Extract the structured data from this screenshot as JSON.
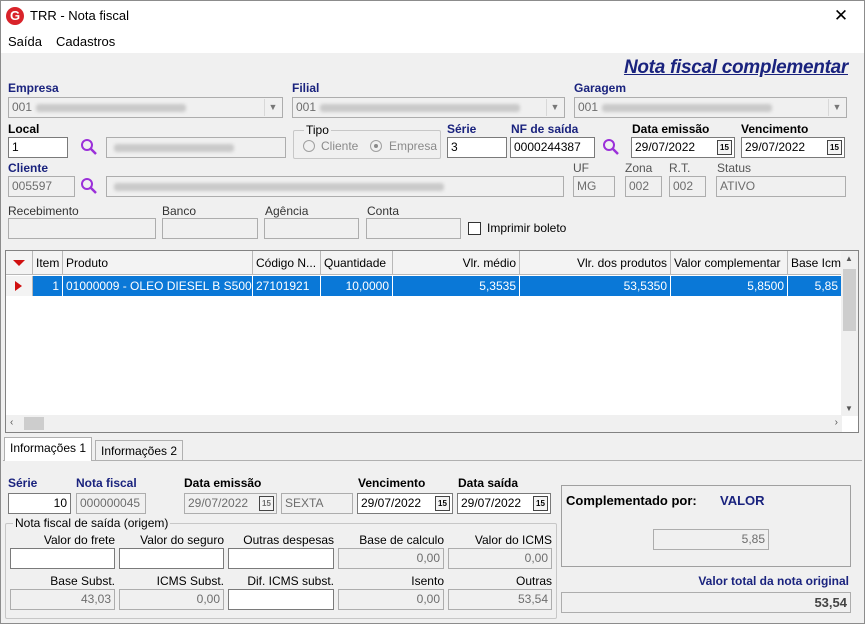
{
  "window": {
    "title": "TRR - Nota fiscal",
    "logo_letter": "G",
    "close": "✕"
  },
  "menu": [
    "Saída",
    "Cadastros"
  ],
  "page_title": "Nota fiscal complementar",
  "empresa": {
    "label": "Empresa",
    "code": "001"
  },
  "filial": {
    "label": "Filial",
    "code": "001"
  },
  "garagem": {
    "label": "Garagem",
    "code": "001"
  },
  "local": {
    "label": "Local",
    "value": "1"
  },
  "tipo": {
    "label": "Tipo",
    "opt1": "Cliente",
    "opt2": "Empresa",
    "selected": "Empresa"
  },
  "serie": {
    "label": "Série",
    "value": "3"
  },
  "nf_saida": {
    "label": "NF de saída",
    "value": "0000244387"
  },
  "data_emissao": {
    "label": "Data emissão",
    "value": "29/07/2022"
  },
  "vencimento": {
    "label": "Vencimento",
    "value": "29/07/2022"
  },
  "cliente": {
    "label": "Cliente",
    "value": "005597"
  },
  "uf": {
    "label": "UF",
    "value": "MG"
  },
  "zona": {
    "label": "Zona",
    "value": "002"
  },
  "rt": {
    "label": "R.T.",
    "value": "002"
  },
  "status": {
    "label": "Status",
    "value": "ATIVO"
  },
  "recebimento": {
    "label": "Recebimento",
    "value": ""
  },
  "banco": {
    "label": "Banco",
    "value": ""
  },
  "agencia": {
    "label": "Agência",
    "value": ""
  },
  "conta": {
    "label": "Conta",
    "value": ""
  },
  "imprimir_boleto": {
    "label": "Imprimir boleto",
    "checked": false
  },
  "grid": {
    "columns": [
      "Item",
      "Produto",
      "Código N...",
      "Quantidade",
      "Vlr. médio",
      "Vlr. dos produtos",
      "Valor complementar",
      "Base Icm"
    ],
    "rows": [
      {
        "item": "1",
        "produto": "01000009 - OLEO DIESEL B S500",
        "codigo": "27101921",
        "quantidade": "10,0000",
        "vlr_medio": "5,3535",
        "vlr_produtos": "53,5350",
        "valor_complementar": "5,8500",
        "base_icm": "5,85"
      }
    ]
  },
  "tabs": [
    "Informações 1",
    "Informações 2"
  ],
  "info": {
    "serie_label": "Série",
    "serie_value": "10",
    "nota_label": "Nota fiscal",
    "nota_value": "000000045",
    "data_emissao_label": "Data emissão",
    "data_emissao_value": "29/07/2022",
    "dia_semana": "SEXTA",
    "vencimento_label": "Vencimento",
    "vencimento_value": "29/07/2022",
    "data_saida_label": "Data saída",
    "data_saida_value": "29/07/2022",
    "group_label": "Nota fiscal de saída (origem)",
    "valor_frete_label": "Valor do frete",
    "valor_frete": "",
    "valor_seguro_label": "Valor do seguro",
    "valor_seguro": "",
    "outras_despesas_label": "Outras despesas",
    "outras_despesas": "",
    "base_calculo_label": "Base de calculo",
    "base_calculo": "0,00",
    "valor_icms_label": "Valor do ICMS",
    "valor_icms": "0,00",
    "base_subst_label": "Base Subst.",
    "base_subst": "43,03",
    "icms_subst_label": "ICMS Subst.",
    "icms_subst": "0,00",
    "dif_icms_label": "Dif. ICMS subst.",
    "dif_icms": "",
    "isento_label": "Isento",
    "isento": "0,00",
    "outras_label": "Outras",
    "outras": "53,54"
  },
  "complementado": {
    "label": "Complementado por:",
    "value": "VALOR",
    "amount": "5,85"
  },
  "valor_total": {
    "label": "Valor total da nota original",
    "value": "53,54"
  },
  "colors": {
    "accent_blue": "#1a237e",
    "selection": "#0a78d7",
    "marker_red": "#d01010"
  }
}
